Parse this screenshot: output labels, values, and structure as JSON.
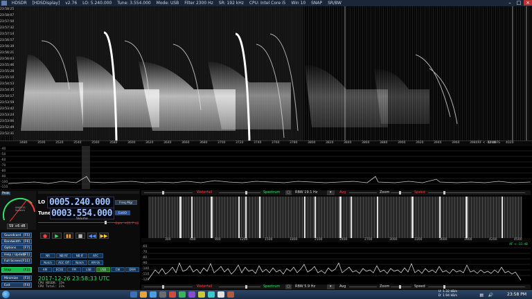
{
  "titlebar": {
    "items": [
      "HDSDR",
      "[HDSDisplay]",
      "v2.76",
      "LO: 5.240.000",
      "Tune: 3.554.000",
      "Mode: USB",
      "Filter 2300 Hz",
      "SR: 192 kHz",
      "CPU: Intel Core i5",
      "Win 10",
      "SNAP",
      "SR/BW"
    ]
  },
  "waterfall": {
    "timestamps": [
      "23:58:25",
      "23:58:07",
      "23:57:50",
      "23:57:32",
      "23:57:14",
      "23:56:57",
      "23:56:39",
      "23:56:21",
      "23:56:03",
      "23:55:46",
      "23:55:28",
      "23:55:10",
      "23:54:53",
      "23:54:35",
      "23:54:17",
      "23:53:59",
      "23:53:42",
      "23:53:24",
      "23:53:06",
      "23:52:49",
      "23:52:31"
    ]
  },
  "freq_axis_1": {
    "ticks": [
      "3480",
      "3500",
      "3520",
      "3540",
      "3560",
      "3580",
      "3600",
      "3620",
      "3640",
      "3660",
      "3680",
      "3700",
      "3720",
      "3740",
      "3760",
      "3780",
      "3800",
      "3820",
      "3840",
      "3860",
      "3880",
      "3900",
      "3920",
      "3940",
      "3960",
      "3980",
      "4000",
      "4020"
    ],
    "rf_label": "RF < -52 dBFS"
  },
  "spectrum_1": {
    "db_labels": [
      "-40",
      "-50",
      "-60",
      "-70",
      "-80",
      "-90",
      "-100",
      "-110"
    ]
  },
  "smeter": {
    "label": "Peak",
    "brand_line1": "ANALOG",
    "brand_line2": "Squelch",
    "reading": "S9 +6 dB",
    "scale": [
      "1",
      "3",
      "5",
      "7",
      "9",
      "+20",
      "+40",
      "+60"
    ]
  },
  "lo": {
    "label": "LO",
    "value": "0005.240.000",
    "button": "Freq.Mgr"
  },
  "tune": {
    "label": "Tune",
    "value": "0003.554.000",
    "button": "ExtIO"
  },
  "volume": {
    "label": "Volume",
    "gain": "Gain: +21.7 dB"
  },
  "fkeys": [
    {
      "label": "Soundcard",
      "key": "[F5]"
    },
    {
      "label": "Bandwidth",
      "key": "[F6]"
    },
    {
      "label": "Options",
      "key": "[F7]"
    },
    {
      "label": "Help / Update",
      "key": "[F1]"
    },
    {
      "label": "Full Screen",
      "key": "[F11]"
    },
    {
      "label": "Stop",
      "key": "[F2]"
    },
    {
      "label": "Minimize",
      "key": "[F3]"
    },
    {
      "label": "Exit",
      "key": "[F4]"
    }
  ],
  "transport": [
    "●",
    "▶",
    "▮▮",
    "■",
    "◀◀",
    "▶▶"
  ],
  "feature_buttons_row1": [
    "NR",
    "NB RF",
    "NB IF",
    "AFC"
  ],
  "feature_buttons_row2": [
    "Notch",
    "AGC Off",
    "Notch",
    "AM-Sh"
  ],
  "mode_buttons": [
    "AM",
    "ECSS",
    "FM",
    "LSB",
    "USB",
    "CW",
    "DRM"
  ],
  "datetime": {
    "date_time": "2017-12-26  23:58:33 UTC",
    "cpu1": "CPU HDSDR: 15%",
    "cpu2": "CPU Total: 21%"
  },
  "controlbar_1": {
    "waterfall": "Waterfall",
    "spectrum": "Spectrum",
    "rbw": "RBW 19.1 Hz",
    "avg": "Avg",
    "zoom": "Zoom",
    "speed": "Speed"
  },
  "freq_axis_2": {
    "ticks": [
      "300",
      "600",
      "900",
      "1200",
      "1500",
      "1800",
      "2100",
      "2400",
      "2700",
      "3000",
      "3300",
      "3600",
      "3900",
      "4200",
      "4500"
    ]
  },
  "spectrum_2": {
    "af_label": "AF < -31 dB",
    "db_labels": [
      "-60",
      "-70",
      "-80",
      "-90",
      "-100",
      "-110",
      "-120"
    ]
  },
  "controlbar_2": {
    "waterfall": "Waterfall",
    "spectrum": "Spectrum",
    "rbw": "RBW 5.9 Hz",
    "avg": "Avg",
    "zoom": "Zoom",
    "speed": "Speed"
  },
  "taskbar": {
    "net_up": "U: 1.32 kB/s",
    "net_down": "D: 1.94 kB/s",
    "clock": "23:58 PM"
  },
  "colors": {
    "accent_blue": "#9fc4ff",
    "red_label": "#ff3b3b",
    "green_label": "#2ee66d",
    "stop_green": "#19b34a"
  }
}
